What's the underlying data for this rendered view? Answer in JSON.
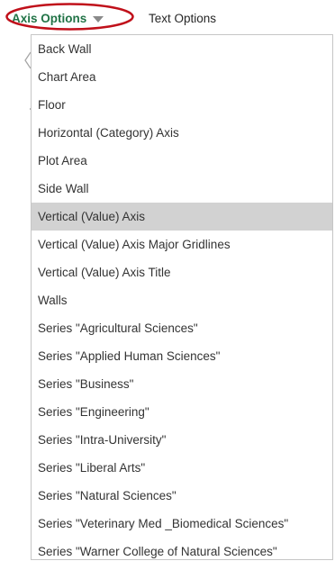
{
  "tabs": {
    "axis_options_label": "Axis Options",
    "text_options_label": "Text Options"
  },
  "colors": {
    "axis_options_text": "#217346",
    "highlight_ring": "#c0101a",
    "selected_row": "#d2d2d2"
  },
  "dropdown": {
    "selected": "Vertical (Value) Axis",
    "items": [
      {
        "label": "Back Wall"
      },
      {
        "label": "Chart Area"
      },
      {
        "label": "Floor"
      },
      {
        "label": "Horizontal (Category) Axis"
      },
      {
        "label": "Plot Area"
      },
      {
        "label": "Side Wall"
      },
      {
        "label": "Vertical (Value) Axis"
      },
      {
        "label": "Vertical (Value) Axis Major Gridlines"
      },
      {
        "label": "Vertical (Value) Axis Title"
      },
      {
        "label": "Walls"
      },
      {
        "label": "Series \"Agricultural Sciences\""
      },
      {
        "label": "Series \"Applied Human Sciences\""
      },
      {
        "label": "Series \"Business\""
      },
      {
        "label": "Series \"Engineering\""
      },
      {
        "label": "Series \"Intra-University\""
      },
      {
        "label": "Series \"Liberal Arts\""
      },
      {
        "label": "Series \"Natural Sciences\""
      },
      {
        "label": "Series \"Veterinary Med _Biomedical Sciences\""
      },
      {
        "label": "Series \"Warner College of Natural Sciences\""
      }
    ]
  }
}
